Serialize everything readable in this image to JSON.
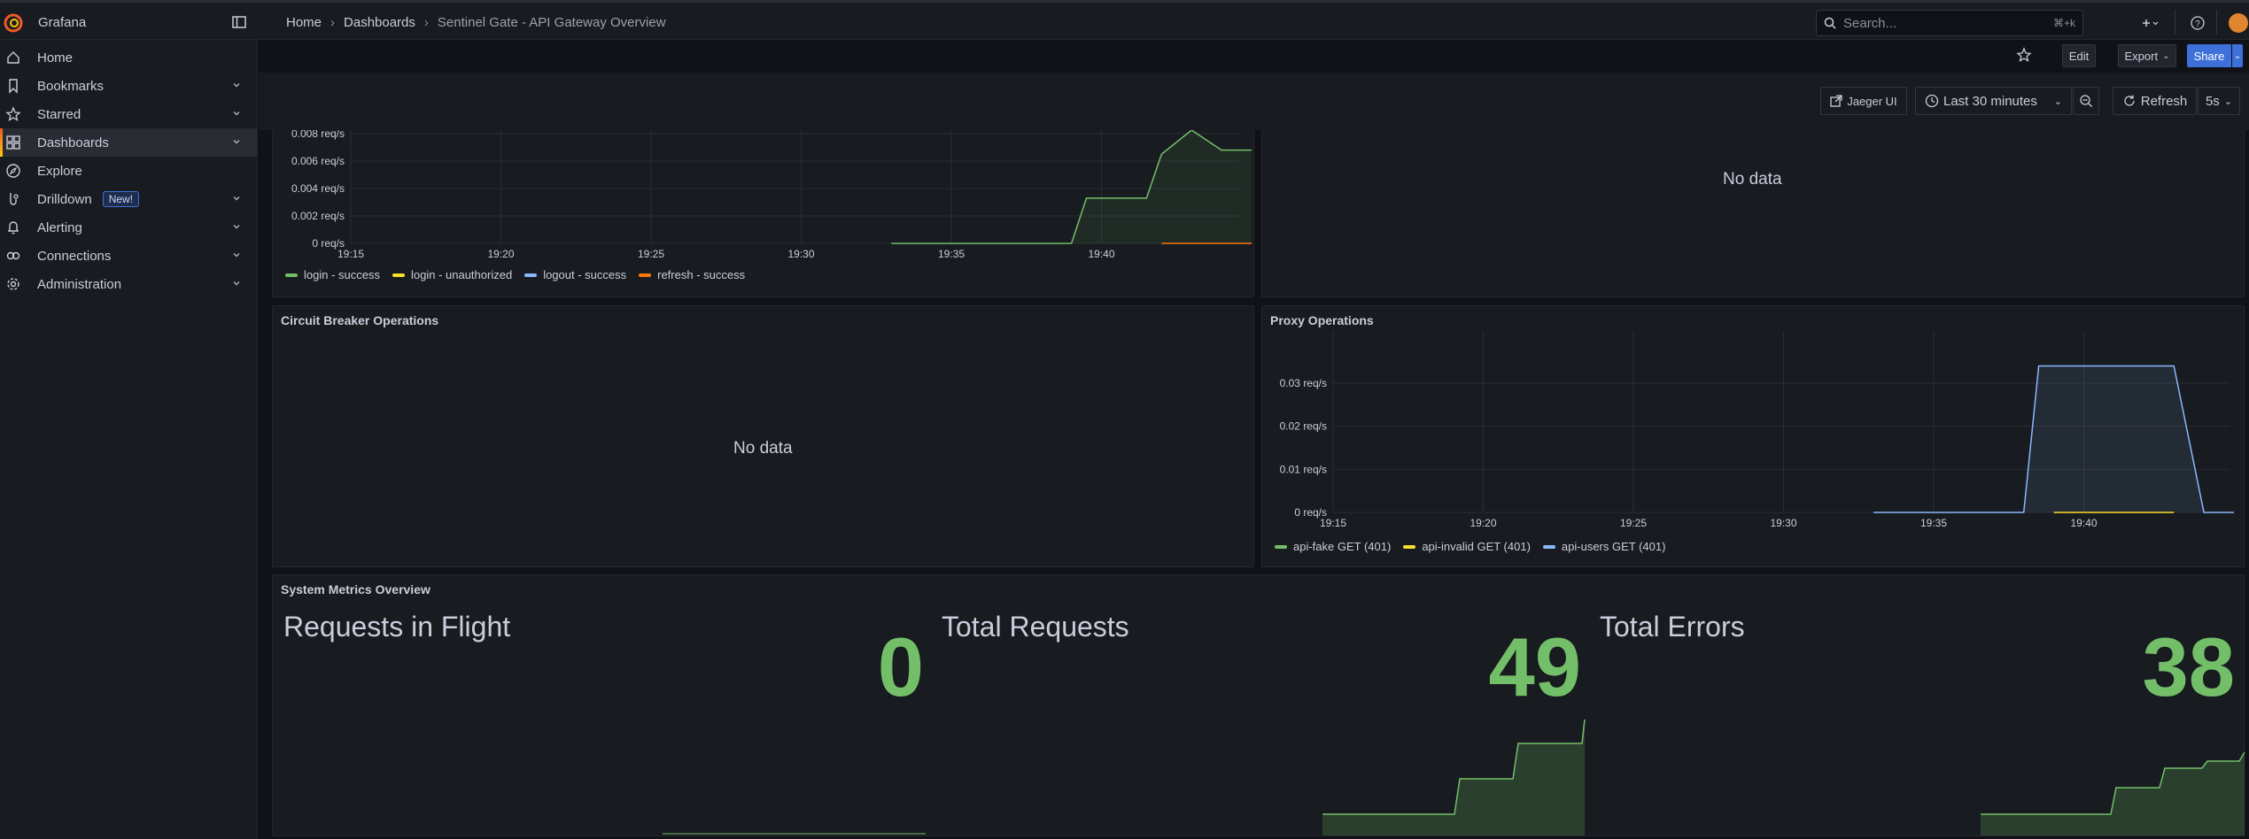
{
  "app": {
    "brand": "Grafana"
  },
  "breadcrumb": [
    "Home",
    "Dashboards",
    "Sentinel Gate - API Gateway Overview"
  ],
  "search": {
    "placeholder": "Search...",
    "shortcut": "⌘+k"
  },
  "sidebar": {
    "items": [
      {
        "label": "Home",
        "icon": "home-icon",
        "chevron": false
      },
      {
        "label": "Bookmarks",
        "icon": "bookmark-icon",
        "chevron": true
      },
      {
        "label": "Starred",
        "icon": "star-icon",
        "chevron": true
      },
      {
        "label": "Dashboards",
        "icon": "grid-icon",
        "chevron": true,
        "active": true
      },
      {
        "label": "Explore",
        "icon": "compass-icon",
        "chevron": false
      },
      {
        "label": "Drilldown",
        "icon": "drilldown-icon",
        "chevron": true,
        "badge": "New!"
      },
      {
        "label": "Alerting",
        "icon": "bell-icon",
        "chevron": true
      },
      {
        "label": "Connections",
        "icon": "link-icon",
        "chevron": true
      },
      {
        "label": "Administration",
        "icon": "gear-icon",
        "chevron": true
      }
    ]
  },
  "actions": {
    "edit": "Edit",
    "export": "Export",
    "share": "Share"
  },
  "controls": {
    "jaeger": "Jaeger UI",
    "time_range": "Last 30 minutes",
    "refresh": "Refresh",
    "interval": "5s"
  },
  "panels": {
    "auth": {
      "legend": [
        {
          "name": "login - success",
          "color": "#73bf69"
        },
        {
          "name": "login - unauthorized",
          "color": "#fade2a"
        },
        {
          "name": "logout - success",
          "color": "#8ab8ff"
        },
        {
          "name": "refresh - success",
          "color": "#ff780a"
        }
      ]
    },
    "top_right": {
      "nodata": "No data"
    },
    "circuit": {
      "title": "Circuit Breaker Operations",
      "nodata": "No data"
    },
    "proxy": {
      "title": "Proxy Operations",
      "legend": [
        {
          "name": "api-fake GET (401)",
          "color": "#73bf69"
        },
        {
          "name": "api-invalid GET (401)",
          "color": "#fade2a"
        },
        {
          "name": "api-users GET (401)",
          "color": "#8ab8ff"
        }
      ]
    },
    "system": {
      "title": "System Metrics Overview",
      "stats": [
        {
          "title": "Requests in Flight",
          "value": "0"
        },
        {
          "title": "Total Requests",
          "value": "49"
        },
        {
          "title": "Total Errors",
          "value": "38"
        }
      ]
    }
  },
  "chart_data": [
    {
      "type": "line",
      "panel": "auth",
      "x_ticks": [
        "19:15",
        "19:20",
        "19:25",
        "19:30",
        "19:35",
        "19:40"
      ],
      "y_ticks": [
        "0 req/s",
        "0.002 req/s",
        "0.004 req/s",
        "0.006 req/s",
        "0.008 req/s"
      ],
      "ylim": [
        0,
        0.008
      ],
      "series": [
        {
          "name": "login - success",
          "color": "#73bf69",
          "x": [
            "19:33",
            "19:34",
            "19:35",
            "19:36",
            "19:37",
            "19:38",
            "19:39",
            "19:39.5",
            "19:41",
            "19:41.5",
            "19:42",
            "19:43",
            "19:44",
            "19:45"
          ],
          "values": [
            0,
            0,
            0,
            0,
            0,
            0,
            0,
            0.0033,
            0.0033,
            0.0033,
            0.0065,
            0.0095,
            0.0068,
            0.0068
          ]
        },
        {
          "name": "refresh - success",
          "color": "#ff780a",
          "x": [
            "19:42",
            "19:43",
            "19:44",
            "19:45"
          ],
          "values": [
            0,
            0,
            0,
            0
          ]
        }
      ]
    },
    {
      "type": "line",
      "panel": "proxy",
      "x_ticks": [
        "19:15",
        "19:20",
        "19:25",
        "19:30",
        "19:35",
        "19:40"
      ],
      "y_ticks": [
        "0 req/s",
        "0.01 req/s",
        "0.02 req/s",
        "0.03 req/s"
      ],
      "ylim": [
        0,
        0.038
      ],
      "series": [
        {
          "name": "api-users GET (401)",
          "color": "#8ab8ff",
          "x": [
            "19:33",
            "19:34",
            "19:35",
            "19:36",
            "19:37",
            "19:38",
            "19:38.5",
            "19:42",
            "19:43",
            "19:44",
            "19:45"
          ],
          "values": [
            0,
            0,
            0,
            0,
            0,
            0,
            0.034,
            0.034,
            0.034,
            0,
            0
          ]
        },
        {
          "name": "api-invalid GET (401)",
          "color": "#fade2a",
          "x": [
            "19:39",
            "19:43"
          ],
          "values": [
            0,
            0
          ]
        }
      ]
    }
  ]
}
